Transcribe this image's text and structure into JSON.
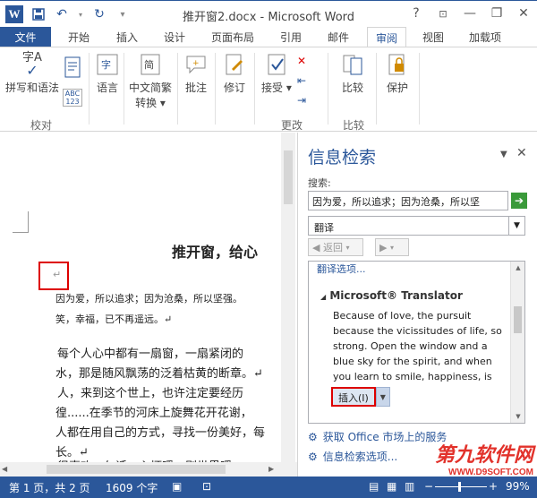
{
  "window": {
    "title": "推开窗2.docx - Microsoft Word",
    "help": "?",
    "minimize": "—",
    "restore": "❐",
    "close": "✕"
  },
  "qat": {
    "logo": "W",
    "save_icon": "save-icon",
    "undo_icon": "undo-icon",
    "redo_icon": "redo-icon",
    "customize_icon": "customize-icon"
  },
  "tabs": {
    "file": "文件",
    "items": [
      "开始",
      "插入",
      "设计",
      "页面布局",
      "引用",
      "邮件",
      "审阅",
      "视图",
      "加载项"
    ],
    "active": "审阅"
  },
  "ribbon": {
    "proofing": {
      "spelling": "拼写和语法",
      "group": "校对"
    },
    "language": "语言",
    "chinese_convert": "中文简繁\n转换",
    "chinese_line1": "中文简繁",
    "chinese_line2": "转换",
    "comments": "批注",
    "track": "修订",
    "accept": "接受",
    "changes_group": "更改",
    "compare": "比较",
    "compare_group": "比较",
    "protect": "保护",
    "spell_icon_text": "字A",
    "abc": "ABC",
    "num": "123"
  },
  "document": {
    "title": "推开窗，给心",
    "cursor_mark": "↵",
    "lines": [
      "因为爱，所以追求；因为沧桑，所以坚强。",
      "笑，幸福，已不再遥远。↵",
      "每个人心中都有一扇窗，一扇紧闭的",
      "水，那是随风飘荡的泛着枯黄的断章。↵",
      "人，来到这个世上，也许注定要经历",
      "徨......在季节的河床上旋舞花开花谢，",
      "人都在用自己的方式，寻找一份美好，每",
      "长。↵",
      "很喜欢一句话：心坏暖，则世界暖"
    ]
  },
  "pane": {
    "title": "信息检索",
    "search_label": "搜索:",
    "search_value": "因为爱，所以追求；因为沧桑，所以坚",
    "service": "翻译",
    "back": "返回",
    "options_link": "翻译选项...",
    "translator_heading": "Microsoft® Translator",
    "translation": "Because of love, the pursuit because the vicissitudes of life, so strong. Open the window and a blue sky for the spirit, and when you learn to smile, happiness, is not far.",
    "insert_button": "插入(I)",
    "office_store": "获取 Office 市场上的服务",
    "research_options": "信息检索选项..."
  },
  "watermark": {
    "brand": "第九软件网",
    "url": "WWW.D9SOFT.COM"
  },
  "status": {
    "page": "第 1 页，共 2 页",
    "words": "1609 个字",
    "zoom": "99%"
  },
  "colors": {
    "accent": "#2b579a",
    "highlight": "#dd0000"
  }
}
